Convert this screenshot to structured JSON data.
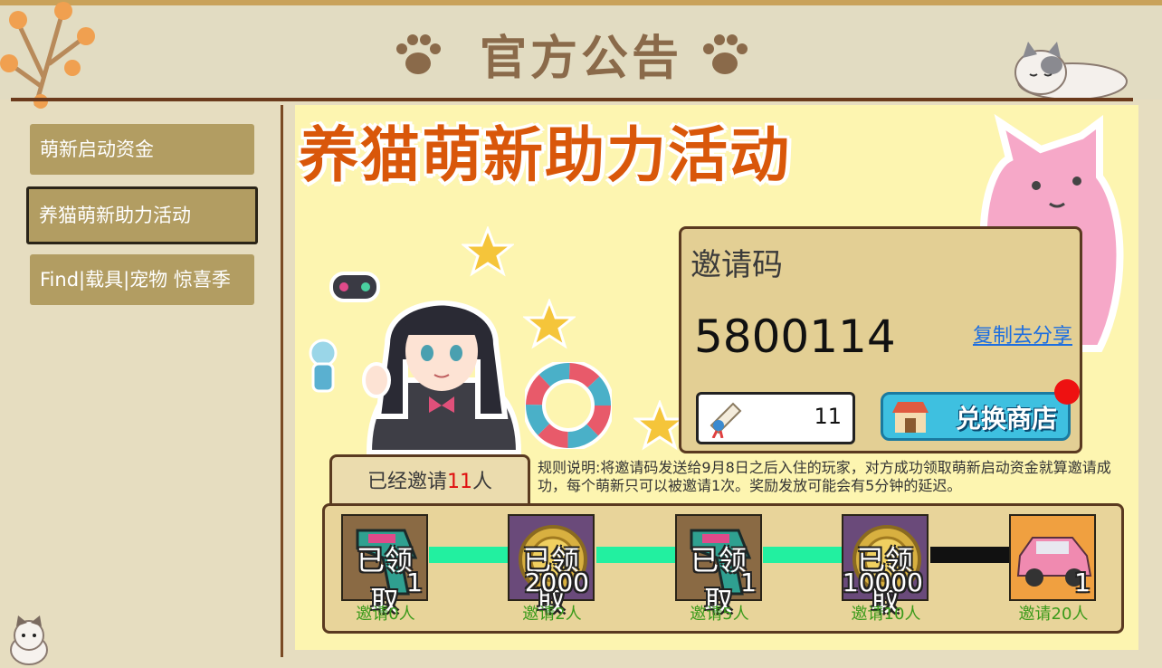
{
  "header": {
    "title": "官方公告"
  },
  "sidebar": {
    "items": [
      {
        "label": "萌新启动资金"
      },
      {
        "label": "养猫萌新助力活动"
      },
      {
        "label": "Find|载具|宠物 惊喜季"
      }
    ],
    "active_index": 1
  },
  "banner": {
    "title": "养猫萌新助力活动"
  },
  "invite": {
    "title": "邀请码",
    "code": "5800114",
    "copy_label": "复制去分享",
    "ticket_count": "11",
    "shop_label": "兑换商店"
  },
  "invited": {
    "prefix": "已经邀请",
    "count": "11",
    "suffix": "人"
  },
  "rules": "规则说明:将邀请码发送给9月8日之后入住的玩家，对方成功领取萌新启动资金就算邀请成功，每个萌新只可以被邀请1次。奖励发放可能会有5分钟的延迟。",
  "rewards": [
    {
      "status": "已领取",
      "amount": "1",
      "requirement": "邀请0人",
      "item": "gun-icon"
    },
    {
      "status": "已领取",
      "amount": "2000",
      "requirement": "邀请2人",
      "item": "coin-icon"
    },
    {
      "status": "已领取",
      "amount": "1",
      "requirement": "邀请5人",
      "item": "gun-icon"
    },
    {
      "status": "已领取",
      "amount": "10000",
      "requirement": "邀请10人",
      "item": "coin-icon"
    },
    {
      "status": "",
      "amount": "1",
      "requirement": "邀请20人",
      "item": "pink-car-icon"
    }
  ],
  "colors": {
    "accent_orange": "#d9570a",
    "progress_done": "#22f0a0",
    "progress_pending": "#111111",
    "notification": "#ee1111"
  }
}
